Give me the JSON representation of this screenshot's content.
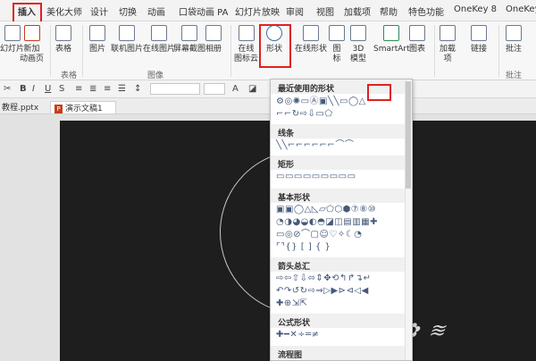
{
  "tabs": [
    "插入",
    "美化大师",
    "设计",
    "切换",
    "动画",
    "口袋动画 PA",
    "幻灯片放映",
    "审阅",
    "视图",
    "加载项",
    "帮助",
    "特色功能",
    "OneKey 8",
    "OneKey"
  ],
  "ribbon": {
    "buttons": [
      {
        "label": "幻灯片",
        "icon": "slide-icon"
      },
      {
        "label": "新加\n动画页",
        "icon": "new-slide-icon"
      },
      {
        "label": "表格",
        "icon": "table-icon"
      },
      {
        "label": "图片",
        "icon": "picture-icon"
      },
      {
        "label": "联机图片",
        "icon": "online-picture-icon"
      },
      {
        "label": "在线图片",
        "icon": "online-image-icon"
      },
      {
        "label": "屏幕截图",
        "icon": "screenshot-icon"
      },
      {
        "label": "相册",
        "icon": "album-icon"
      },
      {
        "label": "在线\n图标云",
        "icon": "icon-cloud-icon"
      },
      {
        "label": "形状",
        "icon": "shapes-icon"
      },
      {
        "label": "在线形状",
        "icon": "online-shapes-icon"
      },
      {
        "label": "图\n标",
        "icon": "icons-icon"
      },
      {
        "label": "3D\n模型",
        "icon": "3d-model-icon"
      },
      {
        "label": "SmartArt",
        "icon": "smartart-icon"
      },
      {
        "label": "图表",
        "icon": "chart-icon"
      },
      {
        "label": "加载\n项",
        "icon": "addins-icon"
      },
      {
        "label": "链接",
        "icon": "link-icon"
      },
      {
        "label": "批注",
        "icon": "comment-icon"
      }
    ],
    "groups": [
      "表格",
      "图像",
      "批注"
    ]
  },
  "doc_tabs": [
    "教程.pptx",
    "演示文稿1"
  ],
  "dropdown": {
    "sections": [
      "最近使用的形状",
      "线条",
      "矩形",
      "基本形状",
      "箭头总汇",
      "公式形状",
      "流程图"
    ]
  },
  "colors": {
    "accent_red": "#e02020",
    "slide_bg": "#1e1e1e",
    "ribbon_bg": "#f7f7f7"
  }
}
